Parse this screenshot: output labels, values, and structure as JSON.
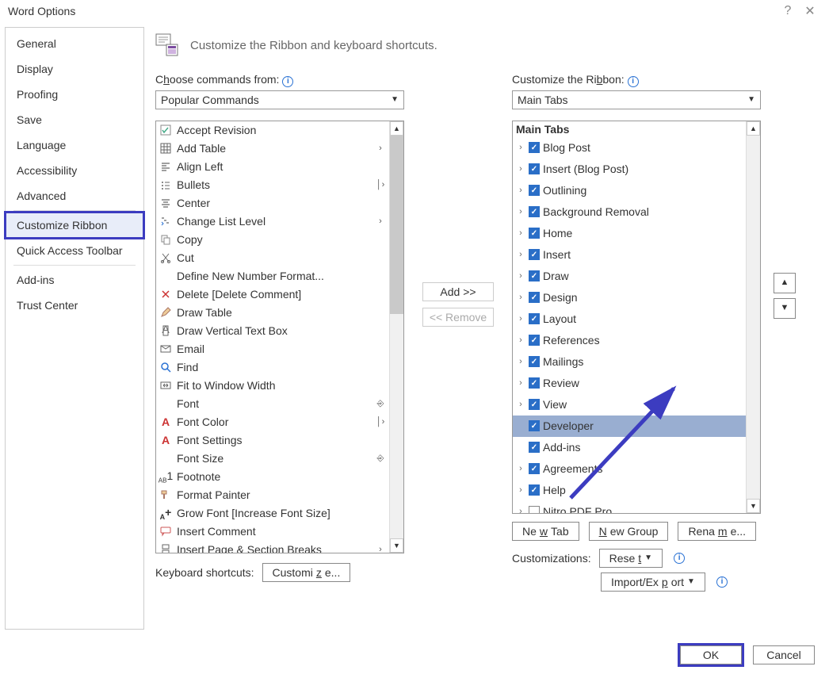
{
  "title": "Word Options",
  "sidebar": [
    "General",
    "Display",
    "Proofing",
    "Save",
    "Language",
    "Accessibility",
    "Advanced",
    "Customize Ribbon",
    "Quick Access Toolbar",
    "Add-ins",
    "Trust Center"
  ],
  "sidebar_selected": 7,
  "header": "Customize the Ribbon and keyboard shortcuts.",
  "left": {
    "label_pre": "C",
    "label_u": "h",
    "label_post": "oose commands from:",
    "dropdown": "Popular Commands",
    "items": [
      {
        "ic": "check",
        "t": "Accept Revision"
      },
      {
        "ic": "tbl",
        "t": "Add Table",
        "r": ">"
      },
      {
        "ic": "align",
        "t": "Align Left"
      },
      {
        "ic": "bul",
        "t": "Bullets",
        "r": "|>"
      },
      {
        "ic": "ctr",
        "t": "Center"
      },
      {
        "ic": "lvl",
        "t": "Change List Level",
        "r": ">"
      },
      {
        "ic": "copy",
        "t": "Copy"
      },
      {
        "ic": "cut",
        "t": "Cut"
      },
      {
        "ic": "",
        "t": "Define New Number Format..."
      },
      {
        "ic": "del",
        "t": "Delete [Delete Comment]"
      },
      {
        "ic": "pen",
        "t": "Draw Table"
      },
      {
        "ic": "vbox",
        "t": "Draw Vertical Text Box"
      },
      {
        "ic": "mail",
        "t": "Email"
      },
      {
        "ic": "find",
        "t": "Find"
      },
      {
        "ic": "fit",
        "t": "Fit to Window Width"
      },
      {
        "ic": "",
        "t": "Font",
        "r": "[I]"
      },
      {
        "ic": "A",
        "t": "Font Color",
        "r": "|>"
      },
      {
        "ic": "A",
        "t": "Font Settings"
      },
      {
        "ic": "",
        "t": "Font Size",
        "r": "[I]"
      },
      {
        "ic": "ab",
        "t": "Footnote"
      },
      {
        "ic": "brush",
        "t": "Format Painter"
      },
      {
        "ic": "A+",
        "t": "Grow Font [Increase Font Size]"
      },
      {
        "ic": "cmt",
        "t": "Insert Comment"
      },
      {
        "ic": "pg",
        "t": "Insert Page & Section Breaks",
        "r": ">"
      }
    ]
  },
  "mid": {
    "add": "Add >>",
    "remove": "<< Remove"
  },
  "right": {
    "label_pre": "Customize the Ri",
    "label_u": "b",
    "label_post": "bon:",
    "dropdown": "Main Tabs",
    "header": "Main Tabs",
    "items": [
      {
        "t": "Blog Post",
        "cb": true
      },
      {
        "t": "Insert (Blog Post)",
        "cb": true
      },
      {
        "t": "Outlining",
        "cb": true
      },
      {
        "t": "Background Removal",
        "cb": true
      },
      {
        "t": "Home",
        "cb": true
      },
      {
        "t": "Insert",
        "cb": true
      },
      {
        "t": "Draw",
        "cb": true
      },
      {
        "t": "Design",
        "cb": true
      },
      {
        "t": "Layout",
        "cb": true
      },
      {
        "t": "References",
        "cb": true
      },
      {
        "t": "Mailings",
        "cb": true
      },
      {
        "t": "Review",
        "cb": true
      },
      {
        "t": "View",
        "cb": true
      },
      {
        "t": "Developer",
        "cb": true,
        "sel": true,
        "noexp": true
      },
      {
        "t": "Add-ins",
        "cb": true,
        "noexp": true
      },
      {
        "t": "Agreements",
        "cb": true
      },
      {
        "t": "Help",
        "cb": true
      },
      {
        "t": "Nitro PDF Pro",
        "cb": false
      }
    ]
  },
  "buttons": {
    "newtab_pre": "Ne",
    "newtab_u": "w",
    "newtab_post": " Tab",
    "newgrp_pre": "",
    "newgrp_u": "N",
    "newgrp_post": "ew Group",
    "rename_pre": "Rena",
    "rename_u": "m",
    "rename_post": "e...",
    "cust_label": "Customizations:",
    "reset": "Rese",
    "reset_u": "t",
    "impexp_pre": "Import/Ex",
    "impexp_u": "p",
    "impexp_post": "ort"
  },
  "kbd": {
    "label": "Keyboard shortcuts:",
    "btn": "Customi",
    "btn_u": "z",
    "btn_post": "e..."
  },
  "footer": {
    "ok": "OK",
    "cancel": "Cancel"
  }
}
